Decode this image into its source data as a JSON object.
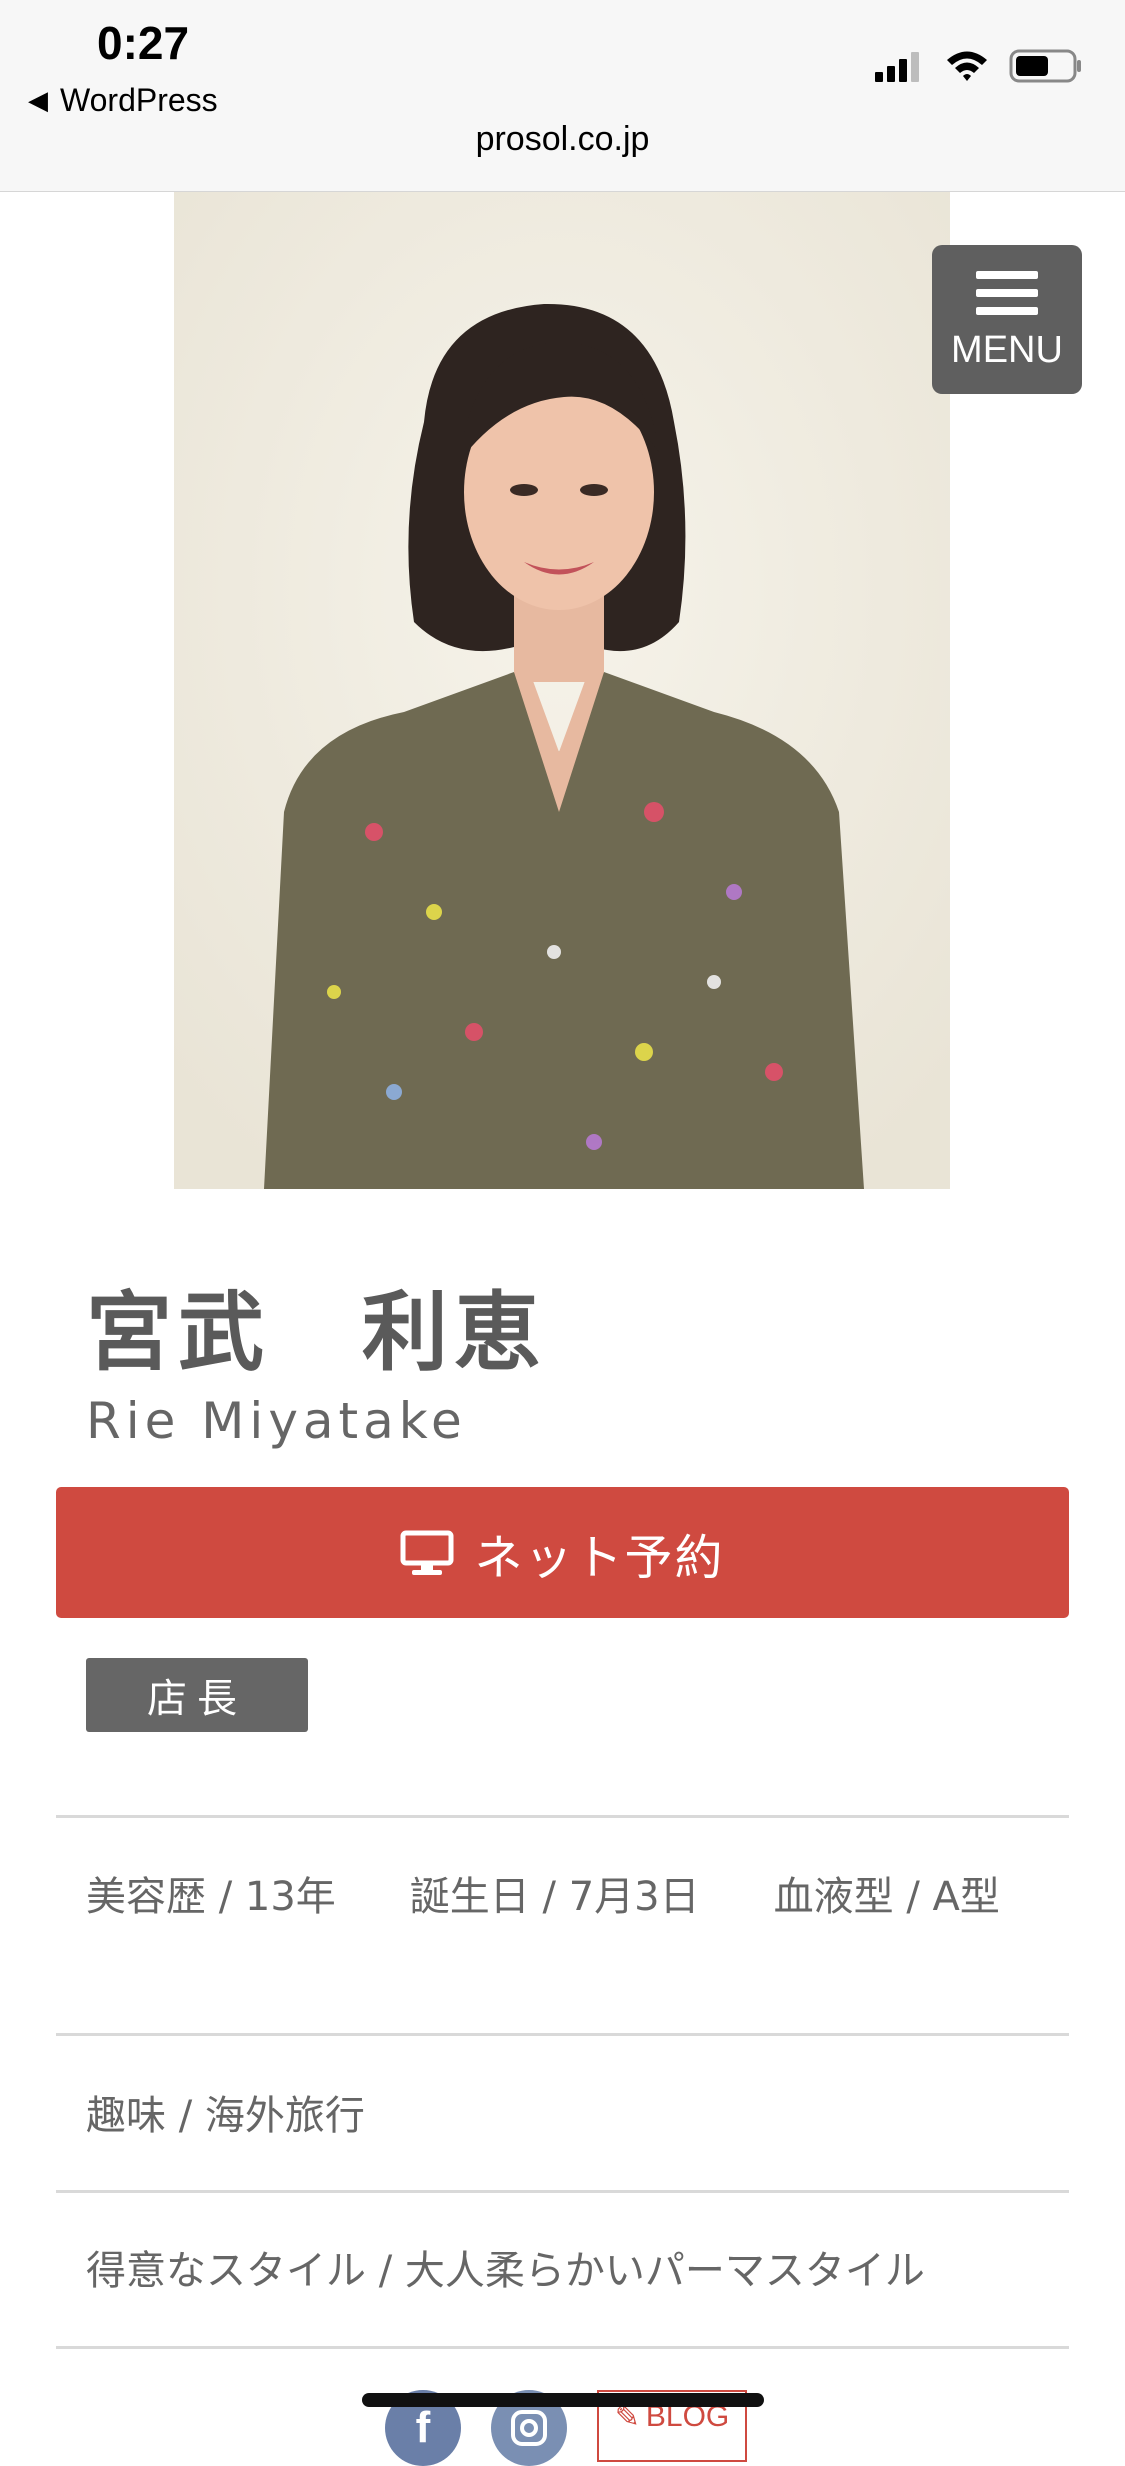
{
  "status_bar": {
    "time": "0:27",
    "back_label": "WordPress",
    "icons": [
      "signal-icon",
      "wifi-icon",
      "battery-icon"
    ]
  },
  "browser": {
    "url": "prosol.co.jp"
  },
  "menu": {
    "label": "MENU"
  },
  "profile": {
    "name_ja": "宮武　利恵",
    "name_en": "Rie Miyatake",
    "reserve_label": "ネット予約",
    "badge": "店長",
    "details": [
      {
        "text": "美容歴 / 13年"
      },
      {
        "text": "誕生日 / 7月3日"
      },
      {
        "text": "血液型 / A型"
      }
    ],
    "hobby": "趣味 / 海外旅行",
    "style": "得意なスタイル / 大人柔らかいパーマスタイル"
  },
  "social": {
    "facebook": "f",
    "blog_label": "BLOG"
  },
  "colors": {
    "accent": "#cf4a40",
    "badge_bg": "#666666",
    "menu_bg": "#5f5f5f",
    "photo_bg": "#f1ede2"
  }
}
